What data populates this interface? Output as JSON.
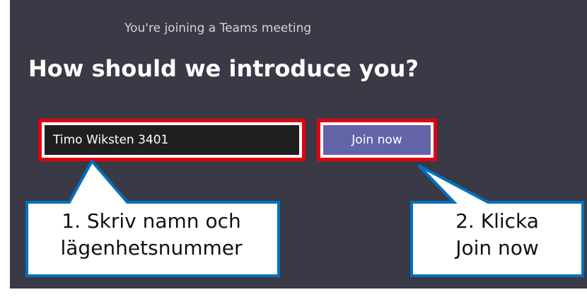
{
  "dialog": {
    "subtitle": "You're joining a Teams meeting",
    "headline": "How should we introduce you?",
    "name_input": {
      "value": "Timo Wiksten 3401",
      "placeholder": ""
    },
    "join_button": "Join now"
  },
  "callouts": {
    "step1": {
      "line1": "1. Skriv namn och",
      "line2": "lägenhetsnummer"
    },
    "step2": {
      "line1": "2. Klicka",
      "line2": "Join now"
    }
  },
  "colors": {
    "background": "#3a3a47",
    "input_background": "#1f1f1f",
    "join_button": "#6264a7",
    "highlight_border": "#e3000f",
    "callout_border": "#0070c0",
    "callout_fill": "#ffffff"
  }
}
